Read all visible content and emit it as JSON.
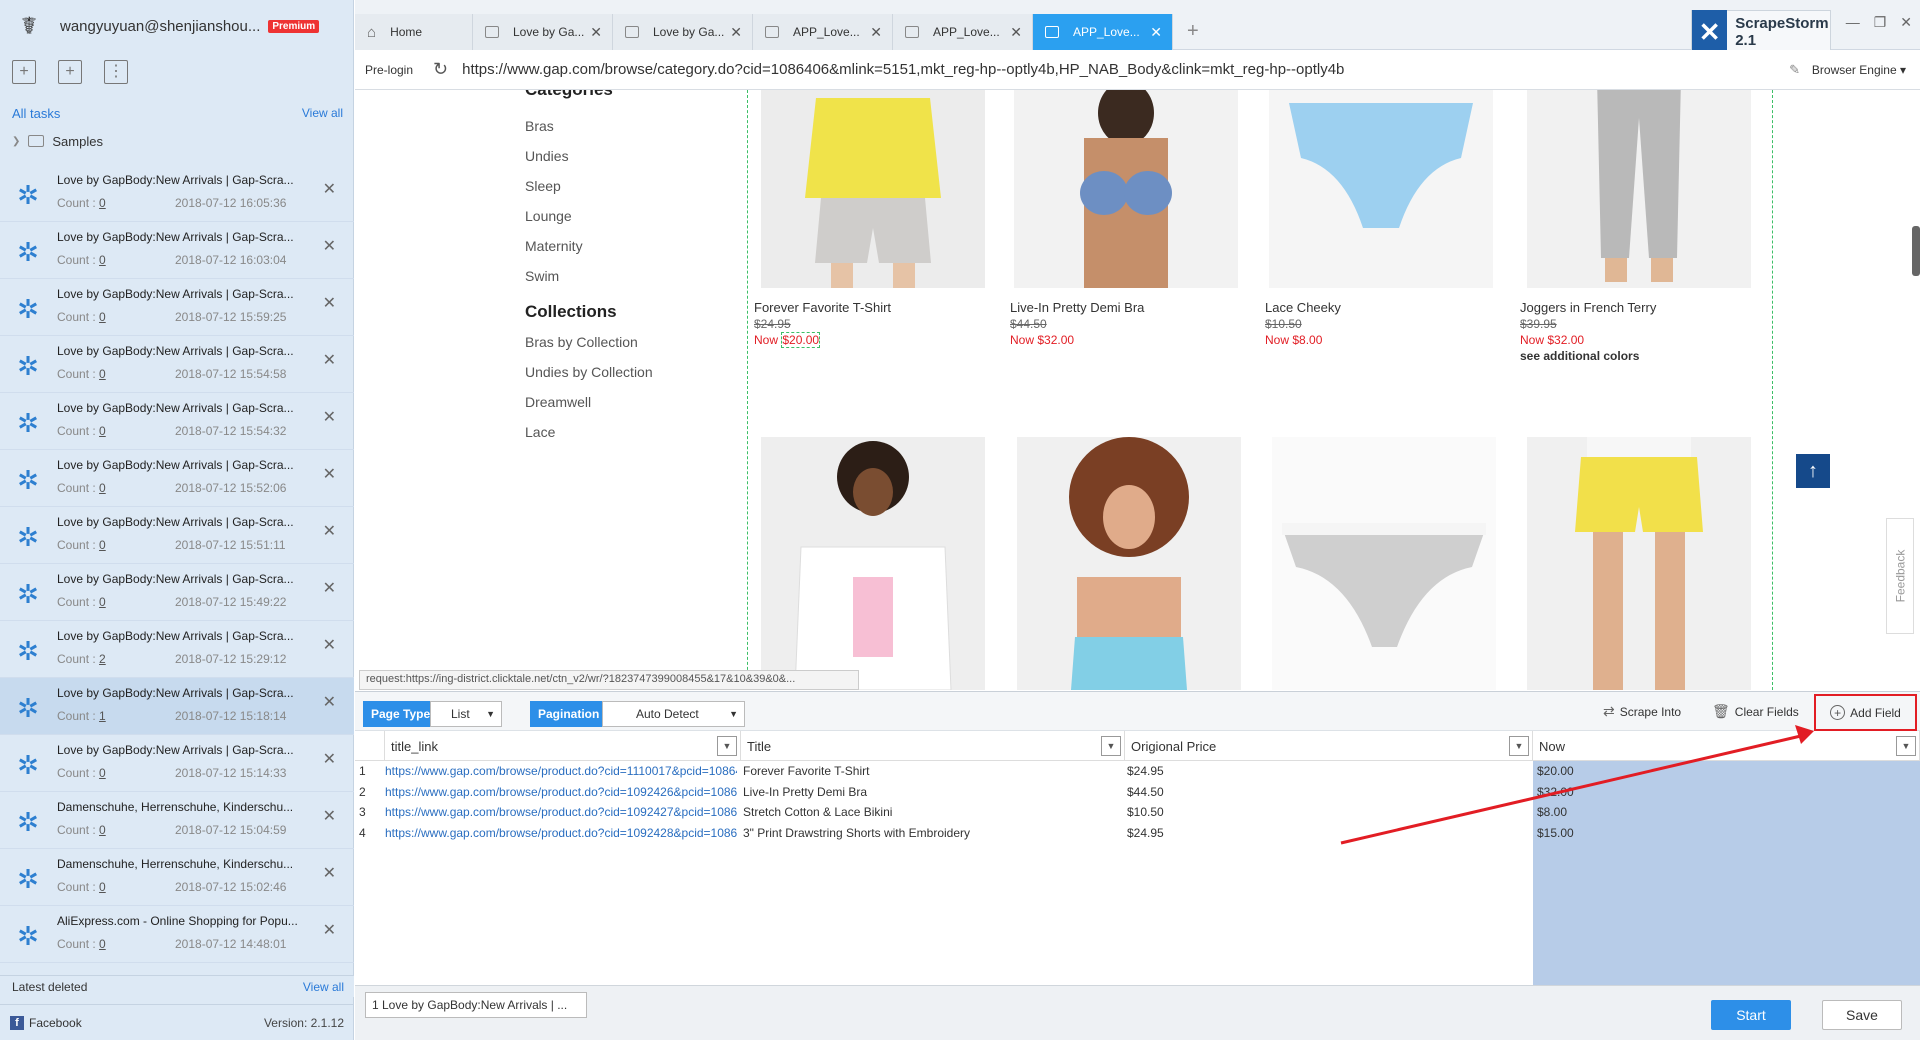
{
  "user": {
    "email": "wangyuyuan@shenjianshou...",
    "badge": "Premium"
  },
  "sidebar": {
    "all_tasks": "All tasks",
    "view_all": "View all",
    "samples": "Samples",
    "latest_deleted": "Latest deleted",
    "view_all_deleted": "View all",
    "facebook": "Facebook",
    "version": "Version: 2.1.12",
    "count_label": "Count :",
    "tasks": [
      {
        "name": "Love by GapBody:New Arrivals | Gap-Scra...",
        "count": "0",
        "date": "2018-07-12 16:05:36"
      },
      {
        "name": "Love by GapBody:New Arrivals | Gap-Scra...",
        "count": "0",
        "date": "2018-07-12 16:03:04"
      },
      {
        "name": "Love by GapBody:New Arrivals | Gap-Scra...",
        "count": "0",
        "date": "2018-07-12 15:59:25"
      },
      {
        "name": "Love by GapBody:New Arrivals | Gap-Scra...",
        "count": "0",
        "date": "2018-07-12 15:54:58"
      },
      {
        "name": "Love by GapBody:New Arrivals | Gap-Scra...",
        "count": "0",
        "date": "2018-07-12 15:54:32"
      },
      {
        "name": "Love by GapBody:New Arrivals | Gap-Scra...",
        "count": "0",
        "date": "2018-07-12 15:52:06"
      },
      {
        "name": "Love by GapBody:New Arrivals | Gap-Scra...",
        "count": "0",
        "date": "2018-07-12 15:51:11"
      },
      {
        "name": "Love by GapBody:New Arrivals | Gap-Scra...",
        "count": "0",
        "date": "2018-07-12 15:49:22"
      },
      {
        "name": "Love by GapBody:New Arrivals | Gap-Scra...",
        "count": "2",
        "date": "2018-07-12 15:29:12"
      },
      {
        "name": "Love by GapBody:New Arrivals | Gap-Scra...",
        "count": "1",
        "date": "2018-07-12 15:18:14"
      },
      {
        "name": "Love by GapBody:New Arrivals | Gap-Scra...",
        "count": "0",
        "date": "2018-07-12 15:14:33"
      },
      {
        "name": "Damenschuhe, Herrenschuhe, Kinderschu...",
        "count": "0",
        "date": "2018-07-12 15:04:59"
      },
      {
        "name": "Damenschuhe, Herrenschuhe, Kinderschu...",
        "count": "0",
        "date": "2018-07-12 15:02:46"
      },
      {
        "name": "AliExpress.com - Online Shopping for Popu...",
        "count": "0",
        "date": "2018-07-12 14:48:01"
      },
      {
        "name": "AliExpress.com - Online Shopping for Popu...",
        "count": "",
        "date": ""
      }
    ]
  },
  "tabs": [
    {
      "label": "Home"
    },
    {
      "label": "Love by Ga..."
    },
    {
      "label": "Love by Ga..."
    },
    {
      "label": "APP_Love..."
    },
    {
      "label": "APP_Love..."
    },
    {
      "label": "APP_Love..."
    }
  ],
  "brand": "ScrapeStorm 2.1",
  "address": {
    "prelogin": "Pre-login",
    "url": "https://www.gap.com/browse/category.do?cid=1086406&mlink=5151,mkt_reg-hp--optly4b,HP_NAB_Body&clink=mkt_reg-hp--optly4b",
    "engine": "Browser Engine"
  },
  "page": {
    "categories_title": "Categories",
    "categories": [
      "Bras",
      "Undies",
      "Sleep",
      "Lounge",
      "Maternity",
      "Swim"
    ],
    "collections_title": "Collections",
    "collections": [
      "Bras by Collection",
      "Undies by Collection",
      "Dreamwell",
      "Lace"
    ],
    "products": [
      {
        "name": "Forever Favorite T-Shirt",
        "old": "$24.95",
        "now_prefix": "Now ",
        "now": "$20.00",
        "more": ""
      },
      {
        "name": "Live-In Pretty Demi Bra",
        "old": "$44.50",
        "now_prefix": "Now ",
        "now": "$32.00",
        "more": ""
      },
      {
        "name": "Lace Cheeky",
        "old": "$10.50",
        "now_prefix": "Now ",
        "now": "$8.00",
        "more": ""
      },
      {
        "name": "Joggers in French Terry",
        "old": "$39.95",
        "now_prefix": "Now ",
        "now": "$32.00",
        "more": "see additional colors"
      }
    ],
    "feedback": "Feedback",
    "status_request": "request:https://ing-district.clicktale.net/ctn_v2/wr/?1823747399008455&17&10&39&0&..."
  },
  "toolbar": {
    "page_type_label": "Page Type",
    "page_type_value": "List",
    "pagination_label": "Pagination",
    "pagination_value": "Auto Detect",
    "scrape_into": "Scrape Into",
    "clear_fields": "Clear Fields",
    "add_field": "Add Field"
  },
  "table": {
    "columns": [
      "title_link",
      "Title",
      "Origional Price",
      "Now"
    ],
    "rows": [
      {
        "idx": "1",
        "link": "https://www.gap.com/browse/product.do?cid=1110017&pcid=10864...",
        "title": "Forever Favorite T-Shirt",
        "price": "$24.95",
        "now": "$20.00"
      },
      {
        "idx": "2",
        "link": "https://www.gap.com/browse/product.do?cid=1092426&pcid=10864...",
        "title": "Live-In Pretty Demi Bra",
        "price": "$44.50",
        "now": "$32.00"
      },
      {
        "idx": "3",
        "link": "https://www.gap.com/browse/product.do?cid=1092427&pcid=10864...",
        "title": "Stretch Cotton & Lace Bikini",
        "price": "$10.50",
        "now": "$8.00"
      },
      {
        "idx": "4",
        "link": "https://www.gap.com/browse/product.do?cid=1092428&pcid=10864...",
        "title": "3\" Print Drawstring Shorts with Embroidery",
        "price": "$24.95",
        "now": "$15.00"
      }
    ]
  },
  "footer": {
    "task_chip": "1 Love by GapBody:New Arrivals | ...",
    "start": "Start",
    "save": "Save"
  },
  "colors": {
    "accent": "#2d8fe8",
    "highlight_red": "#e21d24",
    "sidebar_bg": "#dde9f5",
    "selected_col": "#b7cce8"
  }
}
